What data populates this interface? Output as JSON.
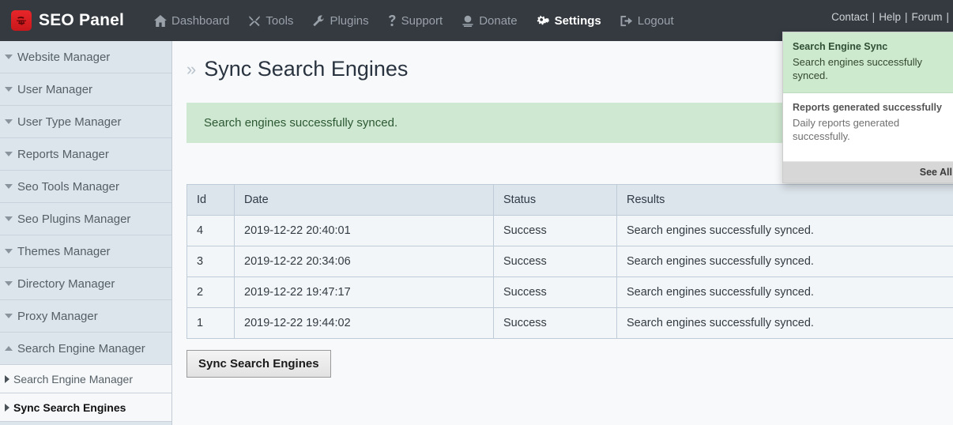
{
  "navbar": {
    "brand": "SEO Panel",
    "logo_icon": "seo-panel-logo-icon",
    "logo_color": "#d8212a",
    "items": [
      {
        "label": "Dashboard",
        "icon": "home-icon",
        "active": false
      },
      {
        "label": "Tools",
        "icon": "tools-icon",
        "active": false
      },
      {
        "label": "Plugins",
        "icon": "wrench-icon",
        "active": false
      },
      {
        "label": "Support",
        "icon": "question-icon",
        "active": false
      },
      {
        "label": "Donate",
        "icon": "donate-icon",
        "active": false
      },
      {
        "label": "Settings",
        "icon": "gears-icon",
        "active": true
      },
      {
        "label": "Logout",
        "icon": "logout-icon",
        "active": false
      }
    ],
    "right_links": [
      {
        "label": "Contact"
      },
      {
        "label": "Help"
      },
      {
        "label": "Forum"
      }
    ],
    "separator": "|"
  },
  "notifications": {
    "items": [
      {
        "title": "Search Engine Sync",
        "body": "Search engines successfully synced.",
        "state": "unread"
      },
      {
        "title": "Reports generated successfully",
        "body": "Daily reports generated successfully.",
        "state": "read"
      }
    ],
    "footer_label": "See All"
  },
  "sidebar": {
    "groups": [
      {
        "label": "Website Manager",
        "expanded": false
      },
      {
        "label": "User Manager",
        "expanded": false
      },
      {
        "label": "User Type Manager",
        "expanded": false
      },
      {
        "label": "Reports Manager",
        "expanded": false
      },
      {
        "label": "Seo Tools Manager",
        "expanded": false
      },
      {
        "label": "Seo Plugins Manager",
        "expanded": false
      },
      {
        "label": "Themes Manager",
        "expanded": false
      },
      {
        "label": "Directory Manager",
        "expanded": false
      },
      {
        "label": "Proxy Manager",
        "expanded": false
      },
      {
        "label": "Search Engine Manager",
        "expanded": true
      }
    ],
    "subitems": [
      {
        "label": "Search Engine Manager",
        "active": false
      },
      {
        "label": "Sync Search Engines",
        "active": true
      }
    ]
  },
  "main": {
    "title": "Sync Search Engines",
    "title_prefix": "»",
    "alert": {
      "message": "Search engines successfully synced.",
      "type": "success",
      "bg_color": "#cfe8d1",
      "text_color": "#2d5834"
    },
    "table": {
      "columns": [
        "Id",
        "Date",
        "Status",
        "Results"
      ],
      "rows": [
        {
          "id": "4",
          "date": "2019-12-22 20:40:01",
          "status": "Success",
          "results": "Search engines successfully synced."
        },
        {
          "id": "3",
          "date": "2019-12-22 20:34:06",
          "status": "Success",
          "results": "Search engines successfully synced."
        },
        {
          "id": "2",
          "date": "2019-12-22 19:47:17",
          "status": "Success",
          "results": "Search engines successfully synced."
        },
        {
          "id": "1",
          "date": "2019-12-22 19:44:02",
          "status": "Success",
          "results": "Search engines successfully synced."
        }
      ],
      "status_color": "#1e8b22"
    },
    "sync_button_label": "Sync Search Engines"
  }
}
